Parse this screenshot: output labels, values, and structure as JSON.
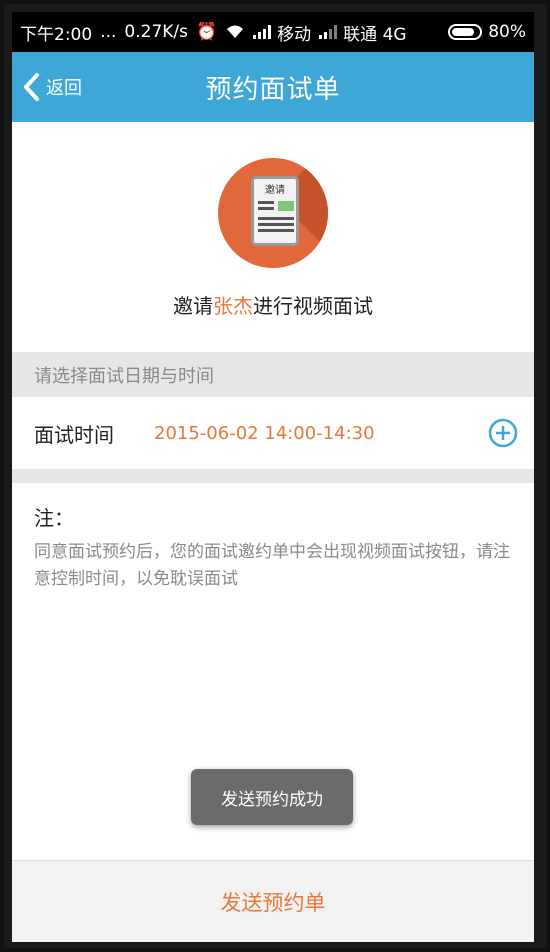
{
  "status_bar": {
    "time": "下午2:00",
    "dots": "...",
    "speed": "0.27K/s",
    "carrier1": "移动",
    "carrier2": "联通 4G",
    "battery": "80%"
  },
  "header": {
    "back_label": "返回",
    "title": "预约面试单"
  },
  "invite": {
    "icon_label": "邀请",
    "prefix": "邀请",
    "name": "张杰",
    "suffix": "进行视频面试"
  },
  "section": {
    "label": "请选择面试日期与时间"
  },
  "time_row": {
    "label": "面试时间",
    "value": "2015-06-02  14:00-14:30"
  },
  "note": {
    "title": "注：",
    "text": "同意面试预约后，您的面试邀约单中会出现视频面试按钮，请注意控制时间，以免耽误面试"
  },
  "toast": {
    "text": "发送预约成功"
  },
  "bottom": {
    "button_label": "发送预约单"
  },
  "colors": {
    "header_bg": "#3fa6d8",
    "accent": "#e8773a",
    "icon_circle": "#e2673b"
  }
}
